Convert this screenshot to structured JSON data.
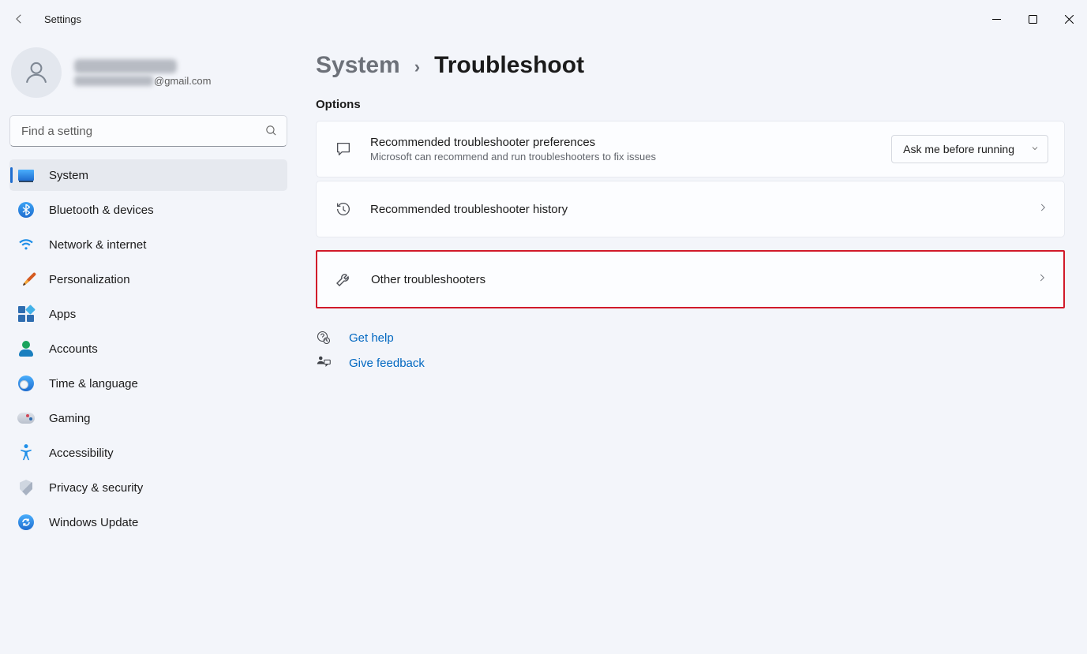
{
  "app": {
    "title": "Settings"
  },
  "user": {
    "email_suffix": "@gmail.com"
  },
  "search": {
    "placeholder": "Find a setting"
  },
  "sidebar": {
    "items": [
      {
        "label": "System"
      },
      {
        "label": "Bluetooth & devices"
      },
      {
        "label": "Network & internet"
      },
      {
        "label": "Personalization"
      },
      {
        "label": "Apps"
      },
      {
        "label": "Accounts"
      },
      {
        "label": "Time & language"
      },
      {
        "label": "Gaming"
      },
      {
        "label": "Accessibility"
      },
      {
        "label": "Privacy & security"
      },
      {
        "label": "Windows Update"
      }
    ]
  },
  "breadcrumb": {
    "parent": "System",
    "current": "Troubleshoot"
  },
  "section": {
    "heading": "Options"
  },
  "cards": {
    "recommended_prefs": {
      "title": "Recommended troubleshooter preferences",
      "subtitle": "Microsoft can recommend and run troubleshooters to fix issues",
      "dropdown_value": "Ask me before running"
    },
    "history": {
      "title": "Recommended troubleshooter history"
    },
    "other": {
      "title": "Other troubleshooters"
    }
  },
  "help": {
    "get_help": "Get help",
    "give_feedback": "Give feedback"
  }
}
